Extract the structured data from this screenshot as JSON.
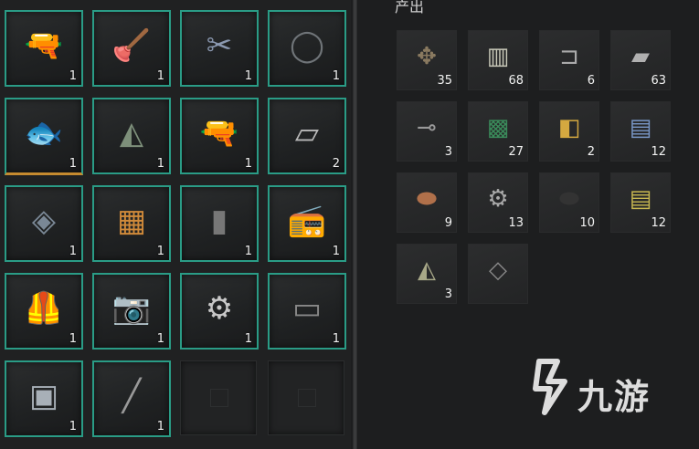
{
  "inventory": {
    "slots": [
      {
        "icon": "drill-icon",
        "glyph": "🔫",
        "count": "1",
        "color": "#c0394a"
      },
      {
        "icon": "plunger-icon",
        "glyph": "🪠",
        "count": "1",
        "color": "#c0394a"
      },
      {
        "icon": "pliers-icon",
        "glyph": "✂",
        "count": "1",
        "color": "#8a98b0"
      },
      {
        "icon": "belt-icon",
        "glyph": "◯",
        "count": "1",
        "color": "#6f7478"
      },
      {
        "icon": "fish-toy-icon",
        "glyph": "🐟",
        "count": "1",
        "color": "#d8d0c0"
      },
      {
        "icon": "fabric-bag-icon",
        "glyph": "◭",
        "count": "1",
        "color": "#7d8f7a"
      },
      {
        "icon": "drill-icon",
        "glyph": "🔫",
        "count": "1",
        "color": "#c0394a"
      },
      {
        "icon": "paper-icon",
        "glyph": "▱",
        "count": "2",
        "color": "#b8b8b8"
      },
      {
        "icon": "tarp-icon",
        "glyph": "◈",
        "count": "1",
        "color": "#7a8896"
      },
      {
        "icon": "muffin-tray-icon",
        "glyph": "▦",
        "count": "1",
        "color": "#d08a3a"
      },
      {
        "icon": "tablet-icon",
        "glyph": "▮",
        "count": "1",
        "color": "#777"
      },
      {
        "icon": "radio-icon",
        "glyph": "📻",
        "count": "1",
        "color": "#888"
      },
      {
        "icon": "vest-icon",
        "glyph": "🦺",
        "count": "1",
        "color": "#b88a48"
      },
      {
        "icon": "camera-icon",
        "glyph": "📷",
        "count": "1",
        "color": "#777"
      },
      {
        "icon": "scrap-metal-icon",
        "glyph": "⚙",
        "count": "1",
        "color": "#c8c8c8"
      },
      {
        "icon": "microwave-icon",
        "glyph": "▭",
        "count": "1",
        "color": "#888"
      },
      {
        "icon": "metal-box-icon",
        "glyph": "▣",
        "count": "1",
        "color": "#a8b0b8"
      },
      {
        "icon": "pen-icon",
        "glyph": "╱",
        "count": "1",
        "color": "#999"
      },
      {
        "icon": "empty-slot",
        "glyph": "",
        "count": "",
        "color": "#333"
      },
      {
        "icon": "empty-slot",
        "glyph": "",
        "count": "",
        "color": "#333"
      }
    ]
  },
  "output": {
    "title": "产出",
    "items": [
      {
        "icon": "sticks-icon",
        "glyph": "✥",
        "count": "35",
        "color": "#8a7a60"
      },
      {
        "icon": "rolled-cloth-icon",
        "glyph": "▥",
        "count": "68",
        "color": "#c8c8b8"
      },
      {
        "icon": "bracket-icon",
        "glyph": "⊐",
        "count": "6",
        "color": "#aaa"
      },
      {
        "icon": "pipe-icon",
        "glyph": "▰",
        "count": "63",
        "color": "#b0b0b0"
      },
      {
        "icon": "screws-icon",
        "glyph": "⊸",
        "count": "3",
        "color": "#999"
      },
      {
        "icon": "circuit-board-icon",
        "glyph": "▩",
        "count": "27",
        "color": "#3a8a5a"
      },
      {
        "icon": "gold-fabric-icon",
        "glyph": "◧",
        "count": "2",
        "color": "#d4a840"
      },
      {
        "icon": "blue-fabric-roll-icon",
        "glyph": "▤",
        "count": "12",
        "color": "#7a98c8"
      },
      {
        "icon": "powder-pile-icon",
        "glyph": "⬬",
        "count": "9",
        "color": "#b0704a"
      },
      {
        "icon": "gear-parts-icon",
        "glyph": "⚙",
        "count": "13",
        "color": "#aaa"
      },
      {
        "icon": "black-granules-icon",
        "glyph": "⬬",
        "count": "10",
        "color": "#333"
      },
      {
        "icon": "yellow-spool-icon",
        "glyph": "▤",
        "count": "12",
        "color": "#c8b850"
      },
      {
        "icon": "cloth-scrap-icon",
        "glyph": "◭",
        "count": "3",
        "color": "#a8a888"
      },
      {
        "icon": "gray-cloth-icon",
        "glyph": "◇",
        "count": "",
        "color": "#888"
      }
    ]
  },
  "watermark": {
    "text": "九游"
  }
}
